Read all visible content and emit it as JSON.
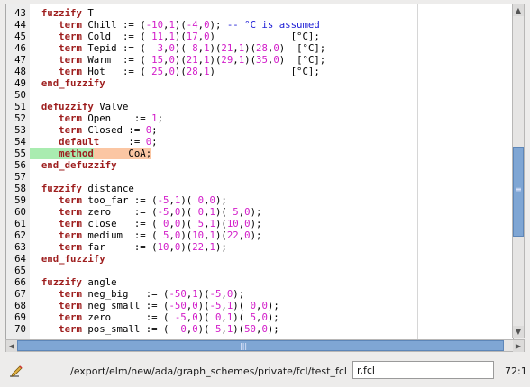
{
  "editor": {
    "first_line": 43,
    "lines": [
      [
        [
          "kw",
          "  fuzzify"
        ],
        [
          "t",
          " T"
        ]
      ],
      [
        [
          "kw",
          "     term"
        ],
        [
          "t",
          " Chill := ("
        ],
        [
          "num",
          "-10"
        ],
        [
          "t",
          ","
        ],
        [
          "num",
          "1"
        ],
        [
          "t",
          ")("
        ],
        [
          "num",
          "-4"
        ],
        [
          "t",
          ","
        ],
        [
          "num",
          "0"
        ],
        [
          "t",
          ");"
        ],
        [
          "cm",
          " -- °C is assumed"
        ]
      ],
      [
        [
          "kw",
          "     term"
        ],
        [
          "t",
          " Cold  := ( "
        ],
        [
          "num",
          "11"
        ],
        [
          "t",
          ","
        ],
        [
          "num",
          "1"
        ],
        [
          "t",
          ")("
        ],
        [
          "num",
          "17"
        ],
        [
          "t",
          ","
        ],
        [
          "num",
          "0"
        ],
        [
          "t",
          ")             [°C];"
        ]
      ],
      [
        [
          "kw",
          "     term"
        ],
        [
          "t",
          " Tepid := (  "
        ],
        [
          "num",
          "3"
        ],
        [
          "t",
          ","
        ],
        [
          "num",
          "0"
        ],
        [
          "t",
          ")( "
        ],
        [
          "num",
          "8"
        ],
        [
          "t",
          ","
        ],
        [
          "num",
          "1"
        ],
        [
          "t",
          ")("
        ],
        [
          "num",
          "21"
        ],
        [
          "t",
          ","
        ],
        [
          "num",
          "1"
        ],
        [
          "t",
          ")("
        ],
        [
          "num",
          "28"
        ],
        [
          "t",
          ","
        ],
        [
          "num",
          "0"
        ],
        [
          "t",
          ")  [°C];"
        ]
      ],
      [
        [
          "kw",
          "     term"
        ],
        [
          "t",
          " Warm  := ( "
        ],
        [
          "num",
          "15"
        ],
        [
          "t",
          ","
        ],
        [
          "num",
          "0"
        ],
        [
          "t",
          ")("
        ],
        [
          "num",
          "21"
        ],
        [
          "t",
          ","
        ],
        [
          "num",
          "1"
        ],
        [
          "t",
          ")("
        ],
        [
          "num",
          "29"
        ],
        [
          "t",
          ","
        ],
        [
          "num",
          "1"
        ],
        [
          "t",
          ")("
        ],
        [
          "num",
          "35"
        ],
        [
          "t",
          ","
        ],
        [
          "num",
          "0"
        ],
        [
          "t",
          ")  [°C];"
        ]
      ],
      [
        [
          "kw",
          "     term"
        ],
        [
          "t",
          " Hot   := ( "
        ],
        [
          "num",
          "25"
        ],
        [
          "t",
          ","
        ],
        [
          "num",
          "0"
        ],
        [
          "t",
          ")("
        ],
        [
          "num",
          "28"
        ],
        [
          "t",
          ","
        ],
        [
          "num",
          "1"
        ],
        [
          "t",
          ")             [°C];"
        ]
      ],
      [
        [
          "kw",
          "  end_fuzzify"
        ]
      ],
      [
        [
          "t",
          ""
        ]
      ],
      [
        [
          "kw",
          "  defuzzify"
        ],
        [
          "t",
          " Valve"
        ]
      ],
      [
        [
          "kw",
          "     term"
        ],
        [
          "t",
          " Open    := "
        ],
        [
          "num",
          "1"
        ],
        [
          "t",
          ";"
        ]
      ],
      [
        [
          "kw",
          "     term"
        ],
        [
          "t",
          " Closed := "
        ],
        [
          "num",
          "0"
        ],
        [
          "t",
          ";"
        ]
      ],
      [
        [
          "kw",
          "     default"
        ],
        [
          "t",
          "     := "
        ],
        [
          "num",
          "0"
        ],
        [
          "t",
          ";"
        ]
      ],
      [
        [
          "kw",
          "     method"
        ],
        [
          "t",
          "      CoA;"
        ]
      ],
      [
        [
          "kw",
          "  end_defuzzify"
        ]
      ],
      [
        [
          "t",
          ""
        ]
      ],
      [
        [
          "kw",
          "  fuzzify"
        ],
        [
          "t",
          " distance"
        ]
      ],
      [
        [
          "kw",
          "     term"
        ],
        [
          "t",
          " too_far := ("
        ],
        [
          "num",
          "-5"
        ],
        [
          "t",
          ","
        ],
        [
          "num",
          "1"
        ],
        [
          "t",
          ")( "
        ],
        [
          "num",
          "0"
        ],
        [
          "t",
          ","
        ],
        [
          "num",
          "0"
        ],
        [
          "t",
          ");"
        ]
      ],
      [
        [
          "kw",
          "     term"
        ],
        [
          "t",
          " zero    := ("
        ],
        [
          "num",
          "-5"
        ],
        [
          "t",
          ","
        ],
        [
          "num",
          "0"
        ],
        [
          "t",
          ")( "
        ],
        [
          "num",
          "0"
        ],
        [
          "t",
          ","
        ],
        [
          "num",
          "1"
        ],
        [
          "t",
          ")( "
        ],
        [
          "num",
          "5"
        ],
        [
          "t",
          ","
        ],
        [
          "num",
          "0"
        ],
        [
          "t",
          ");"
        ]
      ],
      [
        [
          "kw",
          "     term"
        ],
        [
          "t",
          " close   := ( "
        ],
        [
          "num",
          "0"
        ],
        [
          "t",
          ","
        ],
        [
          "num",
          "0"
        ],
        [
          "t",
          ")( "
        ],
        [
          "num",
          "5"
        ],
        [
          "t",
          ","
        ],
        [
          "num",
          "1"
        ],
        [
          "t",
          ")("
        ],
        [
          "num",
          "10"
        ],
        [
          "t",
          ","
        ],
        [
          "num",
          "0"
        ],
        [
          "t",
          ");"
        ]
      ],
      [
        [
          "kw",
          "     term"
        ],
        [
          "t",
          " medium  := ( "
        ],
        [
          "num",
          "5"
        ],
        [
          "t",
          ","
        ],
        [
          "num",
          "0"
        ],
        [
          "t",
          ")("
        ],
        [
          "num",
          "10"
        ],
        [
          "t",
          ","
        ],
        [
          "num",
          "1"
        ],
        [
          "t",
          ")("
        ],
        [
          "num",
          "22"
        ],
        [
          "t",
          ","
        ],
        [
          "num",
          "0"
        ],
        [
          "t",
          ");"
        ]
      ],
      [
        [
          "kw",
          "     term"
        ],
        [
          "t",
          " far     := ("
        ],
        [
          "num",
          "10"
        ],
        [
          "t",
          ","
        ],
        [
          "num",
          "0"
        ],
        [
          "t",
          ")("
        ],
        [
          "num",
          "22"
        ],
        [
          "t",
          ","
        ],
        [
          "num",
          "1"
        ],
        [
          "t",
          ");"
        ]
      ],
      [
        [
          "kw",
          "  end_fuzzify"
        ]
      ],
      [
        [
          "t",
          ""
        ]
      ],
      [
        [
          "kw",
          "  fuzzify"
        ],
        [
          "t",
          " angle"
        ]
      ],
      [
        [
          "kw",
          "     term"
        ],
        [
          "t",
          " neg_big   := ("
        ],
        [
          "num",
          "-50"
        ],
        [
          "t",
          ","
        ],
        [
          "num",
          "1"
        ],
        [
          "t",
          ")("
        ],
        [
          "num",
          "-5"
        ],
        [
          "t",
          ","
        ],
        [
          "num",
          "0"
        ],
        [
          "t",
          ");"
        ]
      ],
      [
        [
          "kw",
          "     term"
        ],
        [
          "t",
          " neg_small := ("
        ],
        [
          "num",
          "-50"
        ],
        [
          "t",
          ","
        ],
        [
          "num",
          "0"
        ],
        [
          "t",
          ")("
        ],
        [
          "num",
          "-5"
        ],
        [
          "t",
          ","
        ],
        [
          "num",
          "1"
        ],
        [
          "t",
          ")( "
        ],
        [
          "num",
          "0"
        ],
        [
          "t",
          ","
        ],
        [
          "num",
          "0"
        ],
        [
          "t",
          ");"
        ]
      ],
      [
        [
          "kw",
          "     term"
        ],
        [
          "t",
          " zero      := ( "
        ],
        [
          "num",
          "-5"
        ],
        [
          "t",
          ","
        ],
        [
          "num",
          "0"
        ],
        [
          "t",
          ")( "
        ],
        [
          "num",
          "0"
        ],
        [
          "t",
          ","
        ],
        [
          "num",
          "1"
        ],
        [
          "t",
          ")( "
        ],
        [
          "num",
          "5"
        ],
        [
          "t",
          ","
        ],
        [
          "num",
          "0"
        ],
        [
          "t",
          ");"
        ]
      ],
      [
        [
          "kw",
          "     term"
        ],
        [
          "t",
          " pos_small := (  "
        ],
        [
          "num",
          "0"
        ],
        [
          "t",
          ","
        ],
        [
          "num",
          "0"
        ],
        [
          "t",
          ")( "
        ],
        [
          "num",
          "5"
        ],
        [
          "t",
          ","
        ],
        [
          "num",
          "1"
        ],
        [
          "t",
          ")("
        ],
        [
          "num",
          "50"
        ],
        [
          "t",
          ","
        ],
        [
          "num",
          "0"
        ],
        [
          "t",
          ");"
        ]
      ]
    ],
    "highlighted_line": 55
  },
  "status": {
    "path": "/export/elm/new/ada/graph_schemes/private/fcl/test_fcl",
    "file_value": "r.fcl",
    "cursor_position": "72:1"
  },
  "icons": {
    "edit": "edit-pencil-icon",
    "scroll_up": "arrow-up-icon",
    "scroll_down": "arrow-down-icon",
    "scroll_left": "arrow-left-icon",
    "scroll_right": "arrow-right-icon"
  },
  "colors": {
    "keyword": "#9e1e1e",
    "number": "#d21cc9",
    "comment": "#2020d6",
    "highlight_keyword_bg": "#a9ecb0",
    "highlight_line_bg": "#fbc6a3",
    "scroll_thumb": "#7fa6d4"
  }
}
